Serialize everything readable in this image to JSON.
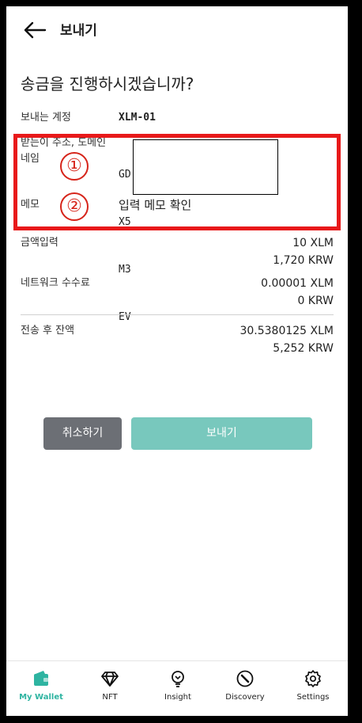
{
  "header": {
    "title": "보내기"
  },
  "question": "송금을 진행하시겠습니까?",
  "account": {
    "label": "보내는 계정",
    "value": "XLM-01"
  },
  "recipient": {
    "label": "받는이 주소, 도메인 네임",
    "lines": [
      "GD",
      "X5",
      "M3",
      "EV"
    ]
  },
  "memo": {
    "label": "메모",
    "value": "입력 메모 확인"
  },
  "annotations": {
    "circle_1": "①",
    "circle_2": "②",
    "highlight_color": "#e8191a"
  },
  "amount": {
    "label": "금액입력",
    "primary": "10 XLM",
    "secondary": "1,720 KRW"
  },
  "fee": {
    "label": "네트워크 수수료",
    "primary": "0.00001 XLM",
    "secondary": "0 KRW"
  },
  "balance": {
    "label": "전송 후 잔액",
    "primary": "30.5380125 XLM",
    "secondary": "5,252 KRW"
  },
  "buttons": {
    "cancel": "취소하기",
    "send": "보내기",
    "cancel_color": "#6c6f75",
    "send_color": "#78c8bd"
  },
  "nav": [
    {
      "label": "My Wallet",
      "icon": "wallet-icon",
      "active": true
    },
    {
      "label": "NFT",
      "icon": "diamond-icon",
      "active": false
    },
    {
      "label": "Insight",
      "icon": "lightbulb-icon",
      "active": false
    },
    {
      "label": "Discovery",
      "icon": "compass-icon",
      "active": false
    },
    {
      "label": "Settings",
      "icon": "gear-icon",
      "active": false
    }
  ],
  "accent_color": "#2eb4a1"
}
